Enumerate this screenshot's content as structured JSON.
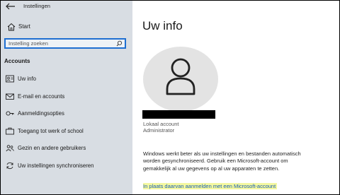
{
  "window": {
    "title": "Instellingen"
  },
  "sidebar": {
    "home_label": "Start",
    "search_placeholder": "Instelling zoeken",
    "section_heading": "Accounts",
    "items": [
      {
        "label": "Uw info",
        "icon": "person-card-icon",
        "active": true
      },
      {
        "label": "E-mail en accounts",
        "icon": "mail-icon"
      },
      {
        "label": "Aanmeldingsopties",
        "icon": "key-icon"
      },
      {
        "label": "Toegang tot werk of school",
        "icon": "briefcase-icon"
      },
      {
        "label": "Gezin en andere gebruikers",
        "icon": "people-icon"
      },
      {
        "label": "Uw instellingen synchroniseren",
        "icon": "sync-icon"
      }
    ]
  },
  "main": {
    "title": "Uw info",
    "account_type": "Lokaal account",
    "account_role": "Administrator",
    "info_text": "Windows werkt beter als uw instellingen en bestanden automatisch worden gesynchroniseerd. Gebruik een Microsoft-account om gemakkelijk al uw gegevens op al uw apparaten te zetten.",
    "link_text": "In plaats daarvan aanmelden met een Microsoft-account"
  },
  "colors": {
    "accent": "#1f6fd1",
    "sidebar_bg": "#d8dde3",
    "link": "#1a5fb4",
    "highlight": "#f4f8a0"
  }
}
